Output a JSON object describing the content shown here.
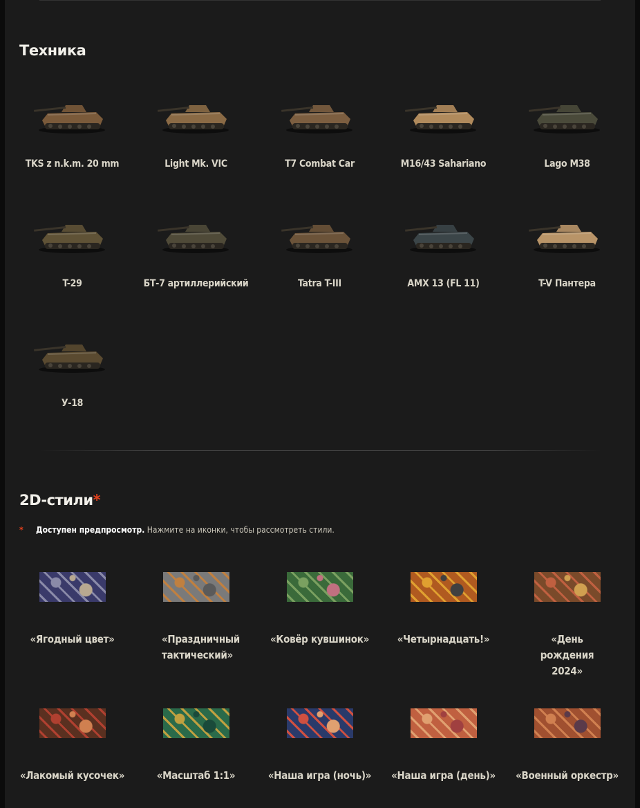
{
  "vehicles_section": {
    "title": "Техника",
    "items": [
      {
        "name": "TKS z n.k.m. 20 mm",
        "color": "#7a5a3a"
      },
      {
        "name": "Light Mk. VIC",
        "color": "#8a6a45"
      },
      {
        "name": "T7 Combat Car",
        "color": "#7c5e40"
      },
      {
        "name": "M16/43 Sahariano",
        "color": "#b08a5c"
      },
      {
        "name": "Lago M38",
        "color": "#4a4a3a"
      },
      {
        "name": "T-29",
        "color": "#5f5236"
      },
      {
        "name": "БТ-7 артиллерийский",
        "color": "#4f4a38"
      },
      {
        "name": "Tatra T-III",
        "color": "#6b5339"
      },
      {
        "name": "AMX 13 (FL 11)",
        "color": "#3b4548"
      },
      {
        "name": "T-V Пантера",
        "color": "#b89468"
      },
      {
        "name": "У-18",
        "color": "#5a4a30"
      }
    ]
  },
  "styles_section": {
    "title": "2D-стили",
    "title_star": "*",
    "note": {
      "asterisk": "*",
      "strong": "Доступен предпросмотр.",
      "text": " Нажмите на иконки, чтобы рассмотреть стили."
    },
    "items": [
      {
        "name": "«Ягодный цвет»",
        "colors": [
          "#3a3a6a",
          "#8a8aa8",
          "#b8a890"
        ]
      },
      {
        "name": "«Праздничный тактический»",
        "colors": [
          "#7a7a7a",
          "#c08040",
          "#5a5a5a"
        ]
      },
      {
        "name": "«Ковёр кувшинок»",
        "colors": [
          "#3a6a3a",
          "#7aa060",
          "#c07080"
        ]
      },
      {
        "name": "«Четырнадцать!»",
        "colors": [
          "#b05a20",
          "#e0a030",
          "#404040"
        ]
      },
      {
        "name": "«День рождения 2024»",
        "colors": [
          "#7a4a2a",
          "#c06040",
          "#d0a050"
        ]
      },
      {
        "name": "«Лакомый кусочек»",
        "colors": [
          "#5a3020",
          "#b04030",
          "#d08050"
        ]
      },
      {
        "name": "«Масштаб 1:1»",
        "colors": [
          "#2a6a4a",
          "#c0a040",
          "#1a4a3a"
        ]
      },
      {
        "name": "«Наша игра (ночь)»",
        "colors": [
          "#2a3a6a",
          "#d05040",
          "#e0a070"
        ]
      },
      {
        "name": "«Наша игра (день)»",
        "colors": [
          "#c06040",
          "#e0a070",
          "#a04040"
        ]
      },
      {
        "name": "«Военный оркестр»",
        "colors": [
          "#a05030",
          "#d08050",
          "#5a3a4a"
        ]
      }
    ]
  }
}
